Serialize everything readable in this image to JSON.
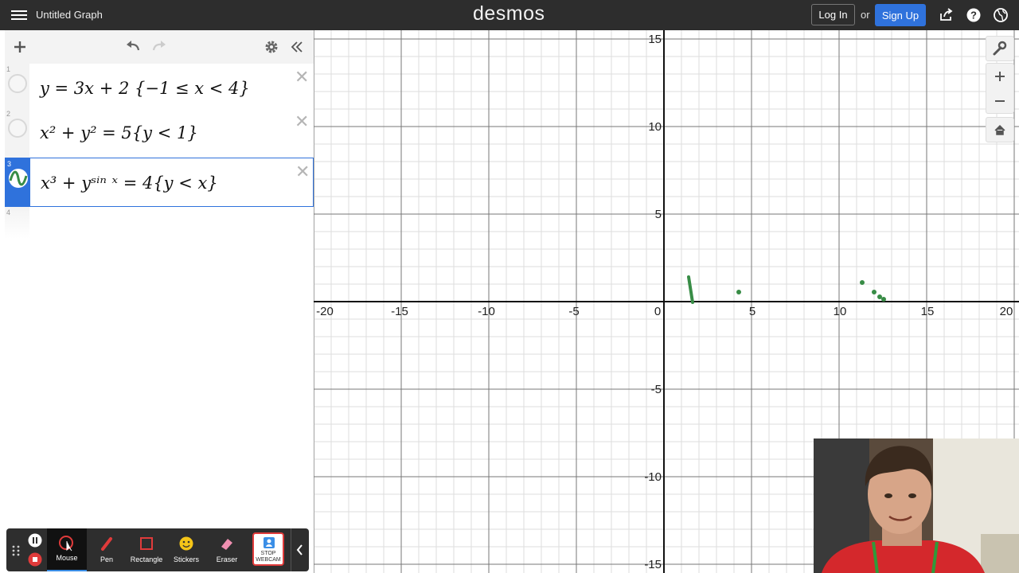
{
  "header": {
    "title": "Untitled Graph",
    "logo": "desmos",
    "login_label": "Log In",
    "or_label": "or",
    "signup_label": "Sign Up",
    "icons": [
      "menu-icon",
      "share-icon",
      "help-icon",
      "globe-icon"
    ]
  },
  "toolbar": {
    "icons": [
      "plus-icon",
      "undo-icon",
      "redo-icon",
      "gear-icon",
      "collapse-icon"
    ]
  },
  "expressions": [
    {
      "num": "1",
      "text": "y = 3x + 2 {−1 ≤ x < 4}"
    },
    {
      "num": "2",
      "text": "x² + y² = 5{y < 1}"
    },
    {
      "num": "3",
      "text": "x³ + yˢⁱⁿ ˣ = 4{y < x}"
    },
    {
      "num": "4",
      "text": ""
    }
  ],
  "graph": {
    "x_labels": [
      "-20",
      "-15",
      "-10",
      "-5",
      "0",
      "5",
      "10",
      "15",
      "20"
    ],
    "y_labels": [
      "15",
      "10",
      "5",
      "-5",
      "-10",
      "-15"
    ],
    "curve_color": "#388c46"
  },
  "right_tools": [
    "wrench-icon",
    "zoom-in-icon",
    "zoom-out-icon",
    "home-icon"
  ],
  "annotation_toolbar": {
    "tools": [
      {
        "label": "Mouse",
        "icon": "mouse-icon"
      },
      {
        "label": "Pen",
        "icon": "pen-icon"
      },
      {
        "label": "Rectangle",
        "icon": "rectangle-icon"
      },
      {
        "label": "Stickers",
        "icon": "sticker-icon"
      },
      {
        "label": "Eraser",
        "icon": "eraser-icon"
      },
      {
        "label": "STOP WEBCAM",
        "icon": "webcam-icon"
      }
    ]
  }
}
